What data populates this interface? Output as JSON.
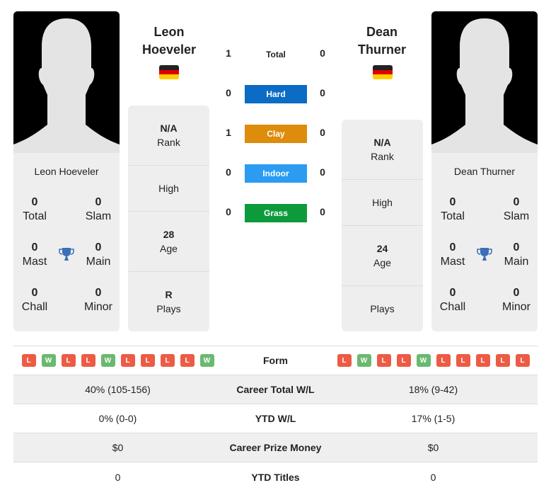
{
  "colors": {
    "hard": "#0a6cc4",
    "clay": "#dd8c0b",
    "indoor": "#2b9cf2",
    "grass": "#0d9a3c",
    "win": "#6ab96f",
    "loss": "#ec5b45",
    "trophy": "#3b6fb8"
  },
  "player1": {
    "first_name": "Leon",
    "last_name": "Hoeveler",
    "full_name": "Leon Hoeveler",
    "flag": "germany-flag",
    "rank": {
      "value": "N/A",
      "label": "Rank"
    },
    "high": {
      "value": "",
      "label": "High"
    },
    "age": {
      "value": "28",
      "label": "Age"
    },
    "plays": {
      "value": "R",
      "label": "Plays"
    },
    "titles": {
      "total": {
        "value": "0",
        "label": "Total"
      },
      "slam": {
        "value": "0",
        "label": "Slam"
      },
      "mast": {
        "value": "0",
        "label": "Mast"
      },
      "main": {
        "value": "0",
        "label": "Main"
      },
      "chall": {
        "value": "0",
        "label": "Chall"
      },
      "minor": {
        "value": "0",
        "label": "Minor"
      }
    }
  },
  "player2": {
    "first_name": "Dean",
    "last_name": "Thurner",
    "full_name": "Dean Thurner",
    "flag": "germany-flag",
    "rank": {
      "value": "N/A",
      "label": "Rank"
    },
    "high": {
      "value": "",
      "label": "High"
    },
    "age": {
      "value": "24",
      "label": "Age"
    },
    "plays": {
      "value": "",
      "label": "Plays"
    },
    "titles": {
      "total": {
        "value": "0",
        "label": "Total"
      },
      "slam": {
        "value": "0",
        "label": "Slam"
      },
      "mast": {
        "value": "0",
        "label": "Mast"
      },
      "main": {
        "value": "0",
        "label": "Main"
      },
      "chall": {
        "value": "0",
        "label": "Chall"
      },
      "minor": {
        "value": "0",
        "label": "Minor"
      }
    }
  },
  "h2h": [
    {
      "label": "Total",
      "p1": "1",
      "p2": "0",
      "surface": "total"
    },
    {
      "label": "Hard",
      "p1": "0",
      "p2": "0",
      "surface": "hard"
    },
    {
      "label": "Clay",
      "p1": "1",
      "p2": "0",
      "surface": "clay"
    },
    {
      "label": "Indoor",
      "p1": "0",
      "p2": "0",
      "surface": "indoor"
    },
    {
      "label": "Grass",
      "p1": "0",
      "p2": "0",
      "surface": "grass"
    }
  ],
  "table": {
    "form_label": "Form",
    "p1_form": [
      "L",
      "W",
      "L",
      "L",
      "W",
      "L",
      "L",
      "L",
      "L",
      "W"
    ],
    "p2_form": [
      "L",
      "W",
      "L",
      "L",
      "W",
      "L",
      "L",
      "L",
      "L",
      "L"
    ],
    "rows": [
      {
        "label": "Career Total W/L",
        "p1": "40% (105-156)",
        "p2": "18% (9-42)"
      },
      {
        "label": "YTD W/L",
        "p1": "0% (0-0)",
        "p2": "17% (1-5)"
      },
      {
        "label": "Career Prize Money",
        "p1": "$0",
        "p2": "$0"
      },
      {
        "label": "YTD Titles",
        "p1": "0",
        "p2": "0"
      }
    ]
  }
}
